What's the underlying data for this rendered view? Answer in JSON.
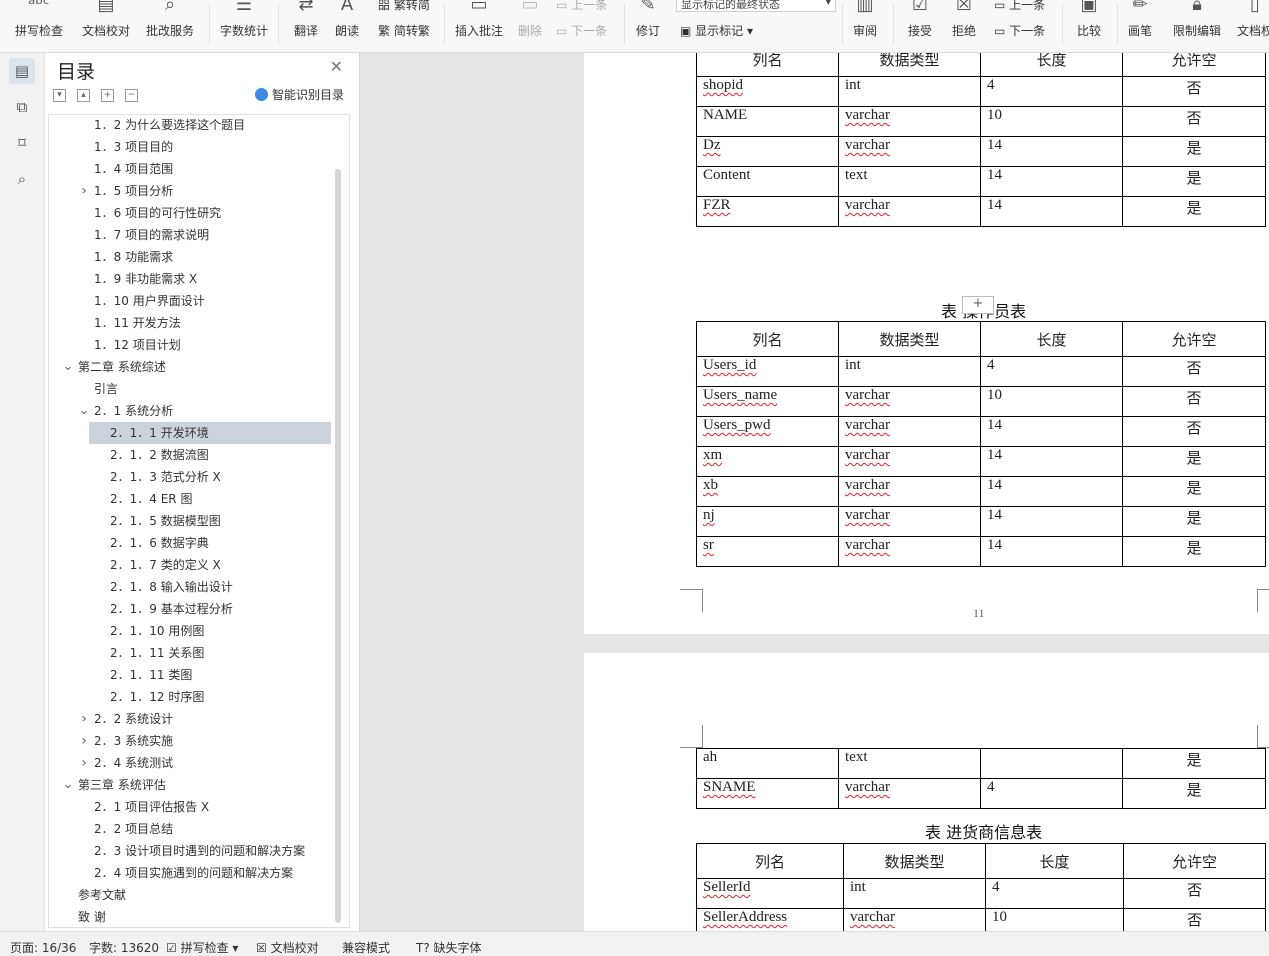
{
  "ribbon": {
    "spell_check": "拼写检查",
    "doc_proofread": "文档校对",
    "batch_service": "批改服务",
    "word_count": "字数统计",
    "translate": "翻译",
    "read_aloud": "朗读",
    "trad_convert": "繁转简",
    "simp_convert": "简转繁",
    "insert_comment": "插入批注",
    "delete": "删除",
    "prev_comment": "上一条",
    "next_comment": "下一条",
    "revise": "修订",
    "markup_state": "显示标记的最终状态",
    "show_markup": "显示标记",
    "review": "审阅",
    "accept": "接受",
    "reject": "拒绝",
    "prev_change": "上一条",
    "next_change": "下一条",
    "compare": "比较",
    "pen": "画笔",
    "restrict_edit": "限制编辑",
    "doc_rights": "文档权"
  },
  "nav": {
    "title": "目录",
    "smart_toc": "智能识别目录",
    "items": [
      {
        "text": "1．2 为什么要选择这个题目",
        "level": 1
      },
      {
        "text": "1．3 项目目的",
        "level": 1
      },
      {
        "text": "1．4 项目范围",
        "level": 1
      },
      {
        "text": "1．5 项目分析",
        "level": 1,
        "chev": "right"
      },
      {
        "text": "1．6 项目的可行性研究",
        "level": 1
      },
      {
        "text": "1．7 项目的需求说明",
        "level": 1
      },
      {
        "text": "1．8 功能需求",
        "level": 1
      },
      {
        "text": "1．9 非功能需求  X",
        "level": 1
      },
      {
        "text": "1．10 用户界面设计",
        "level": 1
      },
      {
        "text": "1．11 开发方法",
        "level": 1
      },
      {
        "text": "1．12 项目计划",
        "level": 1
      },
      {
        "text": "第二章 系统综述",
        "level": 0,
        "chev": "down"
      },
      {
        "text": "引言",
        "level": 1
      },
      {
        "text": "2．1 系统分析",
        "level": 1,
        "chev": "down"
      },
      {
        "text": "2．1．1  开发环境",
        "level": 2,
        "selected": true
      },
      {
        "text": "2．1．2  数据流图",
        "level": 2
      },
      {
        "text": "2．1．3  范式分析   X",
        "level": 2
      },
      {
        "text": "2．1．4  ER 图",
        "level": 2
      },
      {
        "text": "2．1．5  数据模型图",
        "level": 2
      },
      {
        "text": "2．1．6  数据字典",
        "level": 2
      },
      {
        "text": "2．1．7  类的定义   X",
        "level": 2
      },
      {
        "text": "2．1．8  输入输出设计",
        "level": 2
      },
      {
        "text": "2．1．9  基本过程分析",
        "level": 2
      },
      {
        "text": "2．1．10  用例图",
        "level": 2
      },
      {
        "text": "2．1．11  关系图",
        "level": 2
      },
      {
        "text": "2．1．11  类图",
        "level": 2
      },
      {
        "text": "2．1．12  时序图",
        "level": 2
      },
      {
        "text": "2．2 系统设计",
        "level": 1,
        "chev": "right"
      },
      {
        "text": "2．3 系统实施",
        "level": 1,
        "chev": "right"
      },
      {
        "text": "2．4 系统测试",
        "level": 1,
        "chev": "right"
      },
      {
        "text": "第三章 系统评估",
        "level": 0,
        "chev": "down"
      },
      {
        "text": "2．1 项目评估报告  X",
        "level": 1
      },
      {
        "text": "2．2 项目总结",
        "level": 1
      },
      {
        "text": "2．3 设计项目时遇到的问题和解决方案",
        "level": 1
      },
      {
        "text": "2．4 项目实施遇到的问题和解决方案",
        "level": 1
      },
      {
        "text": "参考文献",
        "level": 0
      },
      {
        "text": "致  谢",
        "level": 0
      }
    ]
  },
  "doc": {
    "headers": [
      "列名",
      "数据类型",
      "长度",
      "允许空"
    ],
    "table1_rows": [
      [
        "shopid",
        "int",
        "4",
        "否"
      ],
      [
        "NAME",
        "varchar",
        "10",
        "否"
      ],
      [
        "Dz",
        "varchar",
        "14",
        "是"
      ],
      [
        "Content",
        "text",
        "14",
        "是"
      ],
      [
        "FZR",
        "varchar",
        "14",
        "是"
      ]
    ],
    "caption2": "表 操作员表",
    "table2_rows": [
      [
        "Users_id",
        "int",
        "4",
        "否"
      ],
      [
        "Users_name",
        "varchar",
        "10",
        "否"
      ],
      [
        "Users_pwd",
        "varchar",
        "14",
        "否"
      ],
      [
        "xm",
        "varchar",
        "14",
        "是"
      ],
      [
        "xb",
        "varchar",
        "14",
        "是"
      ],
      [
        "nj",
        "varchar",
        "14",
        "是"
      ],
      [
        "sr",
        "varchar",
        "14",
        "是"
      ]
    ],
    "page_number": "11",
    "table3_rows": [
      [
        "ah",
        "text",
        "",
        "是"
      ],
      [
        "SNAME",
        "varchar",
        "4",
        "是"
      ]
    ],
    "caption4": "表 进货商信息表",
    "table4_rows": [
      [
        "SellerId",
        "int",
        "4",
        "否"
      ],
      [
        "SellerAddress",
        "varchar",
        "10",
        "否"
      ]
    ]
  },
  "status": {
    "page": "页面: 16/36",
    "words": "字数: 13620",
    "spell": "拼写检查",
    "proof": "文档校对",
    "compat": "兼容模式",
    "missing_font": "缺失字体"
  }
}
